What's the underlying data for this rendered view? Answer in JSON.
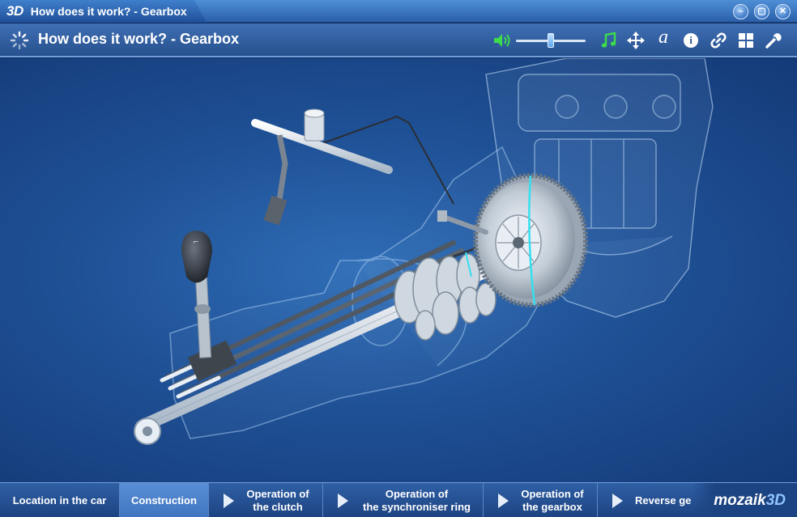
{
  "window": {
    "logo": "3D",
    "title": "How does it work? - Gearbox",
    "controls": {
      "minimize": "–",
      "maximize": "▢",
      "close": "✕"
    }
  },
  "toolbar": {
    "title": "How does it work? - Gearbox",
    "volume": {
      "level": 0.5
    },
    "icons": [
      "music-icon",
      "move-icon",
      "font-icon",
      "info-icon",
      "link-icon",
      "grid-icon",
      "wrench-icon"
    ],
    "accent_green": "#3ddc4a",
    "font_glyph": "a",
    "info_glyph": "i"
  },
  "nav": {
    "tabs": [
      {
        "label": "Location in the car",
        "active": false
      },
      {
        "label": "Construction",
        "active": true
      },
      {
        "line1": "Operation of",
        "line2": "the clutch"
      },
      {
        "line1": "Operation of",
        "line2": "the synchroniser ring"
      },
      {
        "line1": "Operation of",
        "line2": "the gearbox"
      },
      {
        "label": "Reverse ge"
      }
    ],
    "brand_text": "mozaik",
    "brand_suffix": "3D"
  },
  "colors": {
    "background": "#1f5196",
    "toolbar": "#3f6fb4",
    "active_tab": "#4f86d0"
  }
}
